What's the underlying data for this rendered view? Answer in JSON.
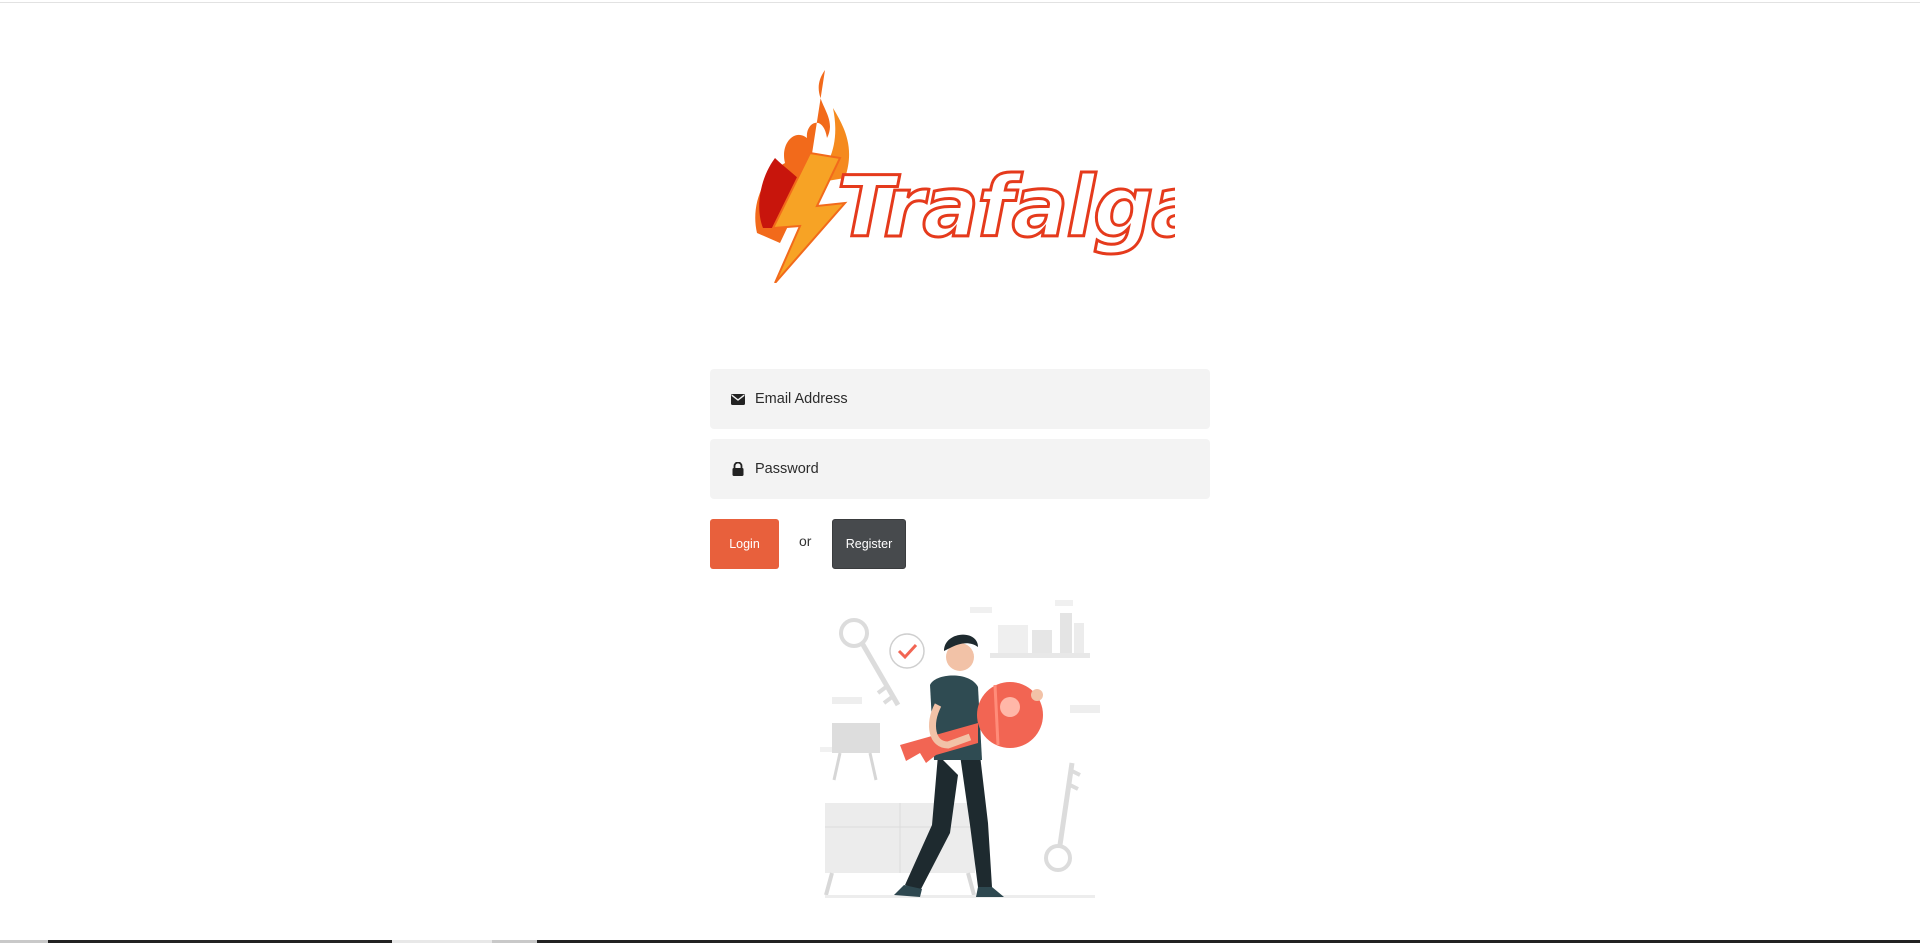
{
  "brand": {
    "logo_text": "Trafalgar",
    "accent_color": "#e8603c",
    "flame_colors": [
      "#ef5a1f",
      "#f7a325",
      "#c8150c"
    ]
  },
  "form": {
    "email": {
      "icon": "envelope-icon",
      "placeholder": "Email Address",
      "value": ""
    },
    "password": {
      "icon": "lock-icon",
      "placeholder": "Password",
      "value": ""
    }
  },
  "actions": {
    "login_label": "Login",
    "separator": "or",
    "register_label": "Register",
    "login_color": "#e8603c",
    "register_color": "#474a4d"
  },
  "illustration": {
    "name": "person-holding-key-illustration",
    "key_color": "#f26553"
  }
}
